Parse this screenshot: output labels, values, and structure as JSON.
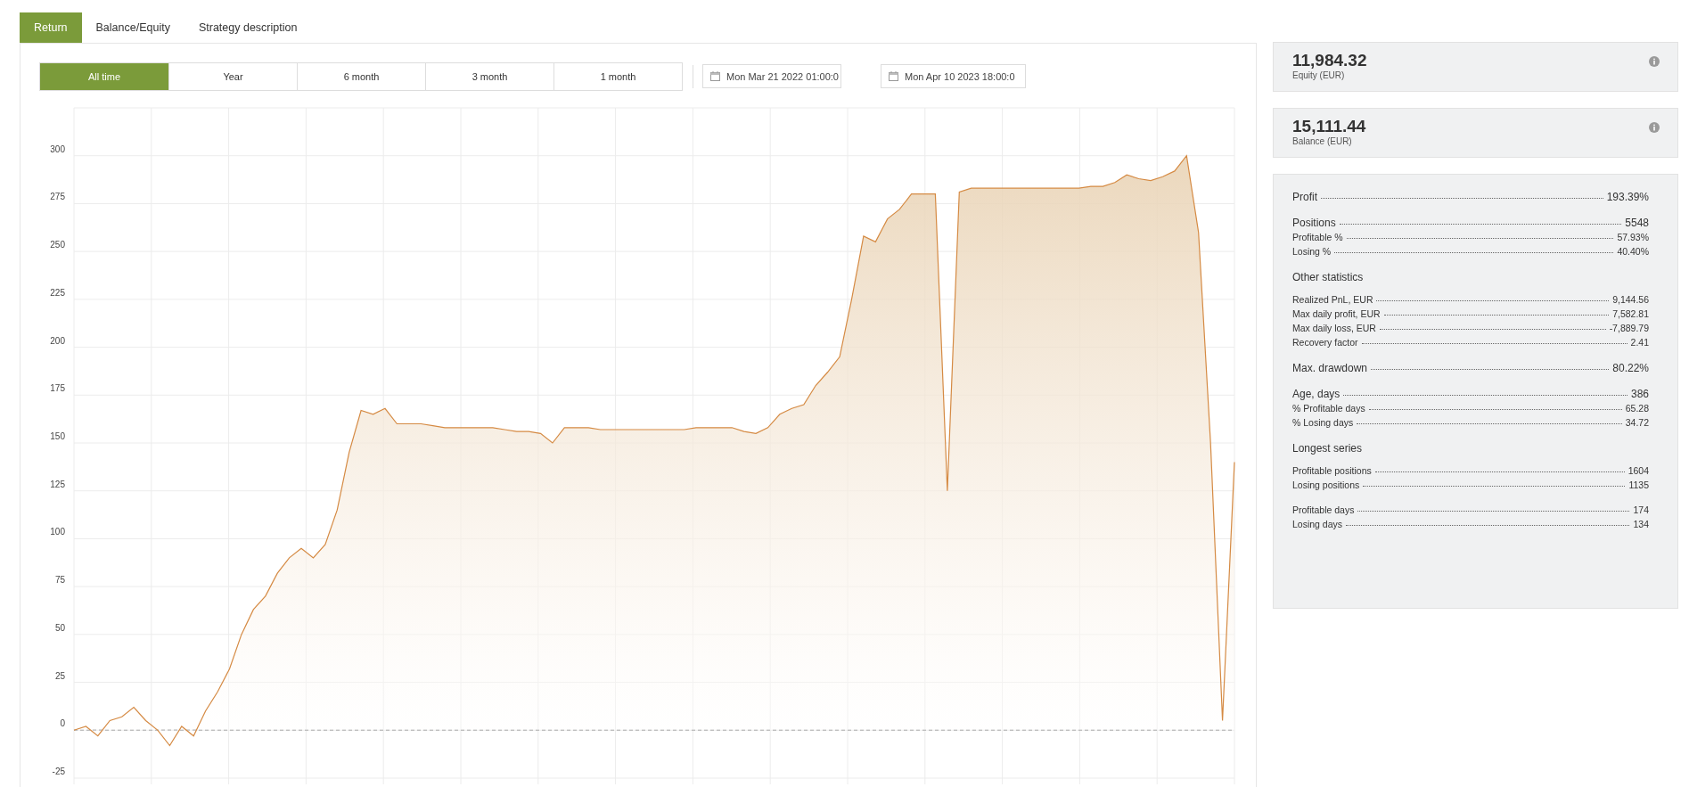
{
  "tabs": [
    {
      "label": "Return",
      "selected": true
    },
    {
      "label": "Balance/Equity",
      "selected": false
    },
    {
      "label": "Strategy description",
      "selected": false
    }
  ],
  "ranges": [
    {
      "label": "All time",
      "selected": true
    },
    {
      "label": "Year",
      "selected": false
    },
    {
      "label": "6 month",
      "selected": false
    },
    {
      "label": "3 month",
      "selected": false
    },
    {
      "label": "1 month",
      "selected": false
    }
  ],
  "date_from": {
    "value": "Mon Mar 21 2022 01:00:0"
  },
  "date_to": {
    "value": "Mon Apr 10 2023 18:00:0"
  },
  "chart_data": {
    "type": "area",
    "grid": true,
    "ref_lines": [
      {
        "axis": "y",
        "value": 0,
        "color": "#b8b8b8"
      }
    ],
    "ylim": [
      -25,
      325
    ],
    "yticks": [
      {
        "value": -25,
        "label": "-25"
      },
      {
        "value": 0,
        "label": "0"
      },
      {
        "value": 25,
        "label": "25"
      },
      {
        "value": 50,
        "label": "50"
      },
      {
        "value": 75,
        "label": "75"
      },
      {
        "value": 100,
        "label": "100"
      },
      {
        "value": 125,
        "label": "125"
      },
      {
        "value": 150,
        "label": "150"
      },
      {
        "value": 175,
        "label": "175"
      },
      {
        "value": 200,
        "label": "200"
      },
      {
        "value": 225,
        "label": "225"
      },
      {
        "value": 250,
        "label": "250"
      },
      {
        "value": 275,
        "label": "275"
      },
      {
        "value": 300,
        "label": "300"
      }
    ],
    "categories": [
      null,
      null,
      null,
      null,
      null,
      null,
      null,
      null,
      null,
      null,
      null,
      null,
      null,
      null,
      null,
      null,
      null,
      null,
      null,
      null,
      null,
      null,
      null,
      null,
      null,
      null,
      null,
      null,
      null,
      null,
      null,
      null,
      null,
      null,
      null,
      null,
      null,
      null,
      null,
      null,
      null,
      null,
      null,
      null,
      null,
      null,
      null,
      null,
      null,
      null,
      null,
      null,
      null,
      null,
      null,
      null,
      null,
      null,
      null,
      null,
      null,
      null,
      null,
      null,
      null,
      null,
      null,
      null,
      null,
      null,
      null,
      null,
      null,
      null,
      null,
      null,
      null,
      null,
      null,
      null,
      null,
      null,
      null,
      null,
      null,
      null,
      null,
      null,
      null,
      null,
      null,
      null,
      null,
      null,
      null,
      null,
      null,
      null
    ],
    "series": [
      {
        "color": "#d58a43",
        "values": [
          0,
          2,
          -3,
          5,
          7,
          12,
          5,
          0,
          -8,
          2,
          -3,
          10,
          20,
          32,
          50,
          63,
          70,
          82,
          90,
          95,
          90,
          97,
          115,
          145,
          167,
          165,
          168,
          160,
          160,
          160,
          159,
          158,
          158,
          158,
          158,
          158,
          157,
          156,
          156,
          155,
          150,
          158,
          158,
          158,
          157,
          157,
          157,
          157,
          157,
          157,
          157,
          157,
          158,
          158,
          158,
          158,
          156,
          155,
          158,
          165,
          168,
          170,
          180,
          187,
          195,
          225,
          258,
          255,
          267,
          272,
          280,
          280,
          280,
          125,
          281,
          283,
          283,
          283,
          283,
          283,
          283,
          283,
          283,
          283,
          283,
          284,
          284,
          286,
          290,
          288,
          287,
          289,
          292,
          300,
          260,
          150,
          5,
          140
        ]
      }
    ]
  },
  "equity": {
    "value": "11,984.32",
    "label": "Equity (EUR)"
  },
  "balance": {
    "value": "15,111.44",
    "label": "Balance (EUR)"
  },
  "stats": [
    {
      "rows": [
        {
          "kind": "major",
          "label": "Profit",
          "value": "193.39%"
        }
      ]
    },
    {
      "rows": [
        {
          "kind": "major",
          "label": "Positions",
          "value": "5548"
        },
        {
          "kind": "minor",
          "label": "Profitable %",
          "value": "57.93%"
        },
        {
          "kind": "minor",
          "label": "Losing %",
          "value": "40.40%"
        }
      ]
    },
    {
      "heading": "Other statistics",
      "rows": [
        {
          "kind": "minor",
          "label": "Realized PnL, EUR",
          "value": "9,144.56"
        },
        {
          "kind": "minor",
          "label": "Max daily profit, EUR",
          "value": "7,582.81"
        },
        {
          "kind": "minor",
          "label": "Max daily loss, EUR",
          "value": "-7,889.79"
        },
        {
          "kind": "minor",
          "label": "Recovery factor",
          "value": "2.41"
        }
      ]
    },
    {
      "rows": [
        {
          "kind": "major",
          "label": "Max. drawdown",
          "value": "80.22%"
        }
      ]
    },
    {
      "rows": [
        {
          "kind": "major",
          "label": "Age, days",
          "value": "386"
        },
        {
          "kind": "minor",
          "label": "% Profitable days",
          "value": "65.28"
        },
        {
          "kind": "minor",
          "label": "% Losing days",
          "value": "34.72"
        }
      ]
    },
    {
      "heading": "Longest series",
      "rows": [
        {
          "kind": "minor",
          "label": "Profitable positions",
          "value": "1604"
        },
        {
          "kind": "minor",
          "label": "Losing positions",
          "value": "1135"
        }
      ]
    },
    {
      "rows": [
        {
          "kind": "minor",
          "label": "Profitable days",
          "value": "174"
        },
        {
          "kind": "minor",
          "label": "Losing days",
          "value": "134"
        }
      ]
    }
  ]
}
